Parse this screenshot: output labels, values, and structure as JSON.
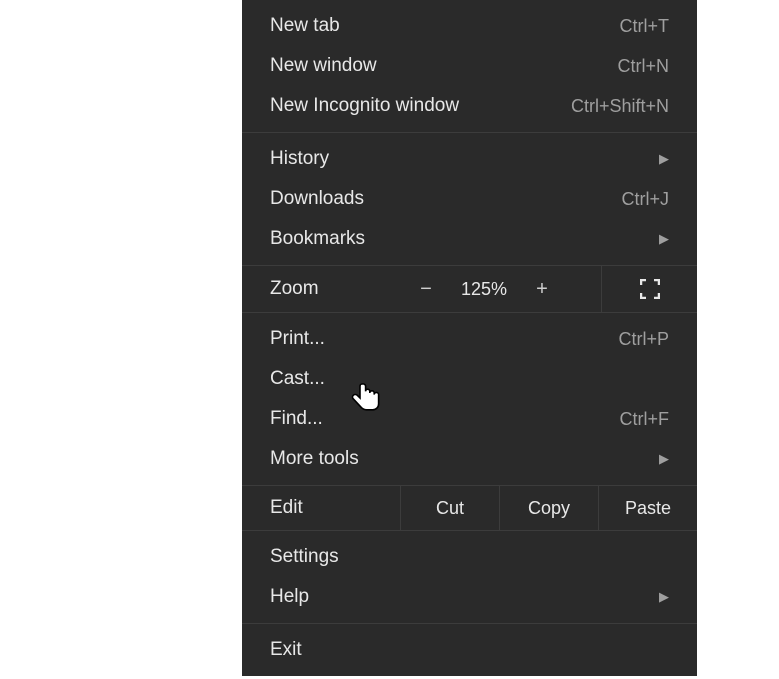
{
  "menu": {
    "sections": [
      {
        "items": [
          {
            "id": "new-tab",
            "label": "New tab",
            "shortcut": "Ctrl+T"
          },
          {
            "id": "new-window",
            "label": "New window",
            "shortcut": "Ctrl+N"
          },
          {
            "id": "new-incognito",
            "label": "New Incognito window",
            "shortcut": "Ctrl+Shift+N"
          }
        ]
      },
      {
        "items": [
          {
            "id": "history",
            "label": "History",
            "submenu": true
          },
          {
            "id": "downloads",
            "label": "Downloads",
            "shortcut": "Ctrl+J"
          },
          {
            "id": "bookmarks",
            "label": "Bookmarks",
            "submenu": true
          }
        ]
      }
    ],
    "zoom": {
      "label": "Zoom",
      "minus": "−",
      "value": "125%",
      "plus": "+"
    },
    "section3": {
      "items": [
        {
          "id": "print",
          "label": "Print...",
          "shortcut": "Ctrl+P"
        },
        {
          "id": "cast",
          "label": "Cast..."
        },
        {
          "id": "find",
          "label": "Find...",
          "shortcut": "Ctrl+F"
        },
        {
          "id": "more-tools",
          "label": "More tools",
          "submenu": true
        }
      ]
    },
    "edit": {
      "label": "Edit",
      "cut": "Cut",
      "copy": "Copy",
      "paste": "Paste"
    },
    "section5": {
      "items": [
        {
          "id": "settings",
          "label": "Settings"
        },
        {
          "id": "help",
          "label": "Help",
          "submenu": true
        }
      ]
    },
    "section6": {
      "items": [
        {
          "id": "exit",
          "label": "Exit"
        }
      ]
    }
  }
}
